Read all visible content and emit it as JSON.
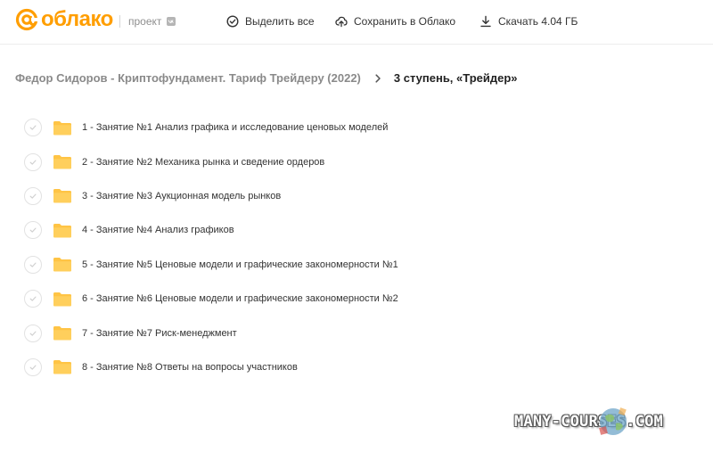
{
  "header": {
    "logo_text": "облако",
    "project_label": "проект",
    "actions": {
      "select_all": "Выделить все",
      "save_to_cloud": "Сохранить в Облако",
      "download": "Скачать 4.04 ГБ"
    }
  },
  "breadcrumb": {
    "parent": "Федор Сидоров - Криптофундамент. Тариф Трейдеру (2022)",
    "current": "3 ступень, «Трейдер»"
  },
  "files": [
    {
      "label": "1 - Занятие №1 Анализ графика и исследование ценовых моделей"
    },
    {
      "label": "2 - Занятие №2 Механика рынка и сведение ордеров"
    },
    {
      "label": "3 - Занятие №3 Аукционная модель рынков"
    },
    {
      "label": "4 - Занятие №4 Анализ графиков"
    },
    {
      "label": "5 - Занятие №5 Ценовые модели и графические закономерности №1"
    },
    {
      "label": "6 - Занятие №6 Ценовые модели и графические закономерности №2"
    },
    {
      "label": "7 - Занятие №7 Риск-менеджмент"
    },
    {
      "label": "8 - Занятие №8 Ответы на вопросы участников"
    }
  ],
  "watermark": "MANY-COURSES.COM",
  "colors": {
    "brand": "#ff9e00",
    "folder": "#ffc445",
    "text": "#333333",
    "muted": "#8a8a8a"
  },
  "icons": {
    "logo": "at-sign-icon",
    "select_all": "check-circle-icon",
    "save": "cloud-upload-icon",
    "download": "download-icon",
    "breadcrumb_sep": "chevron-right-icon",
    "item_check": "checkmark-icon",
    "item_type": "folder-icon"
  }
}
